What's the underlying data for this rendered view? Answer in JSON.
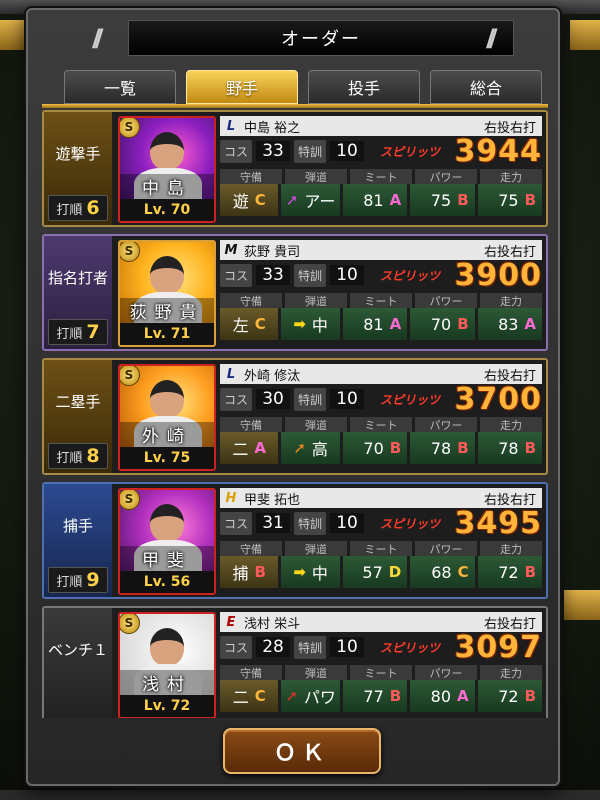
{
  "title": "オーダー",
  "tabs": [
    {
      "label": "一覧",
      "active": false
    },
    {
      "label": "野手",
      "active": true
    },
    {
      "label": "投手",
      "active": false
    },
    {
      "label": "総合",
      "active": false
    }
  ],
  "labels": {
    "cost": "コス",
    "training": "特訓",
    "spirits": "スピリッツ",
    "defense": "守備",
    "trajectory": "弾道",
    "meet": "ミート",
    "power": "パワー",
    "speed": "走力",
    "order": "打順"
  },
  "players": [
    {
      "position": "遊撃手",
      "order": "6",
      "theme": "gold",
      "badge": "S",
      "short_name": "中島",
      "level": "Lv. 70",
      "team_icon": "lions-logo-icon",
      "team_mark": "L",
      "full_name": "中島 裕之",
      "handedness": "右投右打",
      "cost": "33",
      "training": "10",
      "spirits": "3944",
      "defense_pos": "遊",
      "defense_grade": "C",
      "trajectory_arrow": "➚",
      "trajectory_color": "c-pink",
      "trajectory_text": "アー",
      "meet": "81",
      "meet_grade": "A",
      "power": "75",
      "power_grade": "B",
      "speed": "75",
      "speed_grade": "B"
    },
    {
      "position": "指名打者",
      "order": "7",
      "theme": "purple",
      "badge": "S",
      "short_name": "荻野貴",
      "level": "Lv. 71",
      "team_icon": "marines-logo-icon",
      "team_mark": "M",
      "full_name": "荻野 貴司",
      "handedness": "右投右打",
      "cost": "33",
      "training": "10",
      "spirits": "3900",
      "defense_pos": "左",
      "defense_grade": "C",
      "trajectory_arrow": "➡",
      "trajectory_color": "c-yellow",
      "trajectory_text": "中",
      "meet": "81",
      "meet_grade": "A",
      "power": "70",
      "power_grade": "B",
      "speed": "83",
      "speed_grade": "A"
    },
    {
      "position": "二塁手",
      "order": "8",
      "theme": "gold",
      "badge": "S",
      "short_name": "外崎",
      "level": "Lv. 75",
      "team_icon": "lions-logo-icon",
      "team_mark": "L",
      "full_name": "外崎 修汰",
      "handedness": "右投右打",
      "cost": "30",
      "training": "10",
      "spirits": "3700",
      "defense_pos": "二",
      "defense_grade": "A",
      "trajectory_arrow": "➚",
      "trajectory_color": "c-orange",
      "trajectory_text": "高",
      "meet": "70",
      "meet_grade": "B",
      "power": "78",
      "power_grade": "B",
      "speed": "78",
      "speed_grade": "B"
    },
    {
      "position": "捕手",
      "order": "9",
      "theme": "blue",
      "badge": "S",
      "short_name": "甲斐",
      "level": "Lv. 56",
      "team_icon": "hawks-logo-icon",
      "team_mark": "H",
      "full_name": "甲斐 拓也",
      "handedness": "右投右打",
      "cost": "31",
      "training": "10",
      "spirits": "3495",
      "defense_pos": "捕",
      "defense_grade": "B",
      "trajectory_arrow": "➡",
      "trajectory_color": "c-yellow",
      "trajectory_text": "中",
      "meet": "57",
      "meet_grade": "D",
      "power": "68",
      "power_grade": "C",
      "speed": "72",
      "speed_grade": "B"
    },
    {
      "position": "ベンチ１",
      "order": "",
      "theme": "grey",
      "badge": "S",
      "short_name": "浅村",
      "level": "Lv. 72",
      "team_icon": "eagles-logo-icon",
      "team_mark": "E",
      "full_name": "浅村 栄斗",
      "handedness": "右投右打",
      "cost": "28",
      "training": "10",
      "spirits": "3097",
      "defense_pos": "二",
      "defense_grade": "C",
      "trajectory_arrow": "➚",
      "trajectory_color": "c-red",
      "trajectory_text": "パワ",
      "meet": "77",
      "meet_grade": "B",
      "power": "80",
      "power_grade": "A",
      "speed": "72",
      "speed_grade": "B"
    }
  ],
  "ok_button": "ＯＫ"
}
